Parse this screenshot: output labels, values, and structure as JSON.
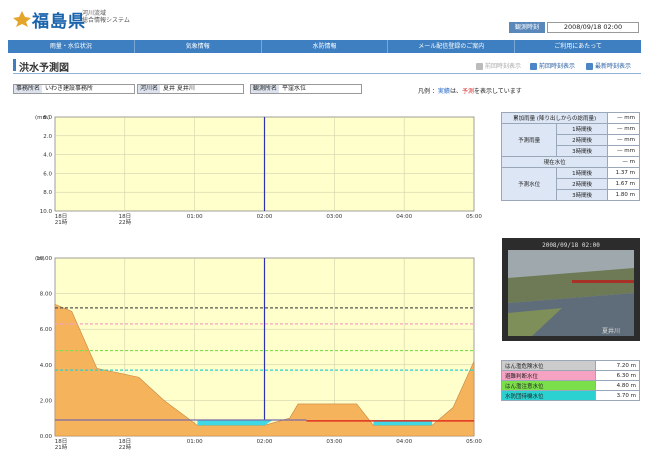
{
  "header": {
    "title": "福島県",
    "subtitle_line1": "河川流域",
    "subtitle_line2": "総合情報システム",
    "datetime_label": "観測時刻",
    "datetime_value": "2008/09/18 02:00"
  },
  "nav": {
    "items": [
      "雨量・水位状況",
      "気象情報",
      "水防情報",
      "メール配信登録のご案内",
      "ご利用にあたって"
    ]
  },
  "section": {
    "title": "洪水予測図"
  },
  "toolbar": {
    "prev_label": "前回時刻表示",
    "next_label": "前回時刻表示",
    "latest_label": "最新時刻表示"
  },
  "info": {
    "office_label": "事務所名",
    "office_value": "いわき建設事務所",
    "river_label": "河川名",
    "river_value": "夏井 夏井川",
    "station_label": "観測所名",
    "station_value": "平窪水位"
  },
  "legend_note": {
    "prefix": "凡例 ：",
    "blue": "実績",
    "sep": "は、",
    "red": "予測",
    "suffix": "を表示しています"
  },
  "rain_chart": {
    "y_unit": "(mm)",
    "yticks": [
      "8.0",
      "2.0",
      "4.0",
      "6.0",
      "8.0",
      "10.0"
    ],
    "xticks": [
      {
        "l1": "18日",
        "l2": "21時"
      },
      {
        "l1": "18日",
        "l2": "22時"
      },
      {
        "l1": "01:00",
        "l2": ""
      },
      {
        "l1": "02:00",
        "l2": ""
      },
      {
        "l1": "03:00",
        "l2": ""
      },
      {
        "l1": "04:00",
        "l2": ""
      },
      {
        "l1": "05:00",
        "l2": ""
      }
    ]
  },
  "level_chart": {
    "y_unit": "(m)",
    "yticks": [
      "10.00",
      "8.00",
      "6.00",
      "4.00",
      "2.00",
      "0.00"
    ],
    "xticks": [
      {
        "l1": "18日",
        "l2": "21時"
      },
      {
        "l1": "18日",
        "l2": "22時"
      },
      {
        "l1": "01:00",
        "l2": ""
      },
      {
        "l1": "02:00",
        "l2": ""
      },
      {
        "l1": "03:00",
        "l2": ""
      },
      {
        "l1": "04:00",
        "l2": ""
      },
      {
        "l1": "05:00",
        "l2": ""
      }
    ]
  },
  "colors": {
    "plot_bg": "#ffffcc",
    "area_fill": "#f5b45c",
    "water_fill": "#41d8e6",
    "now_line": "#3030b0",
    "level_danger": "#f6a2c2",
    "level_flood": "#7adf4a",
    "level_warning": "#2bd1d1",
    "level_top": "#555555",
    "forecast_line": "#e03020"
  },
  "side_table": {
    "r1_label": "累加雨量\n(降り出しからの総雨量)",
    "r1_value": "— mm",
    "r2_group": "予測雨量",
    "r2_sub": "1時間後",
    "r2_value": "— mm",
    "r3_sub": "2時間後",
    "r3_value": "— mm",
    "r4_sub": "3時間後",
    "r4_value": "— mm",
    "r5_label": "現在水位",
    "r5_value": "— m",
    "r6_group": "予測水位",
    "r6_sub": "1時間後",
    "r6_value": "1.37 m",
    "r7_sub": "2時間後",
    "r7_value": "1.67 m",
    "r8_sub": "3時間後",
    "r8_value": "1.80 m"
  },
  "camera": {
    "timestamp": "2008/09/18 02:00",
    "caption": "夏井川"
  },
  "level_table": [
    {
      "label": "はん濫危険水位",
      "value": "7.20 m",
      "color": "#cccccc"
    },
    {
      "label": "避難判断水位",
      "value": "6.30 m",
      "color": "#f6a2c2"
    },
    {
      "label": "はん濫注意水位",
      "value": "4.80 m",
      "color": "#7adf4a"
    },
    {
      "label": "水防団待機水位",
      "value": "3.70 m",
      "color": "#2bd1d1"
    }
  ]
}
